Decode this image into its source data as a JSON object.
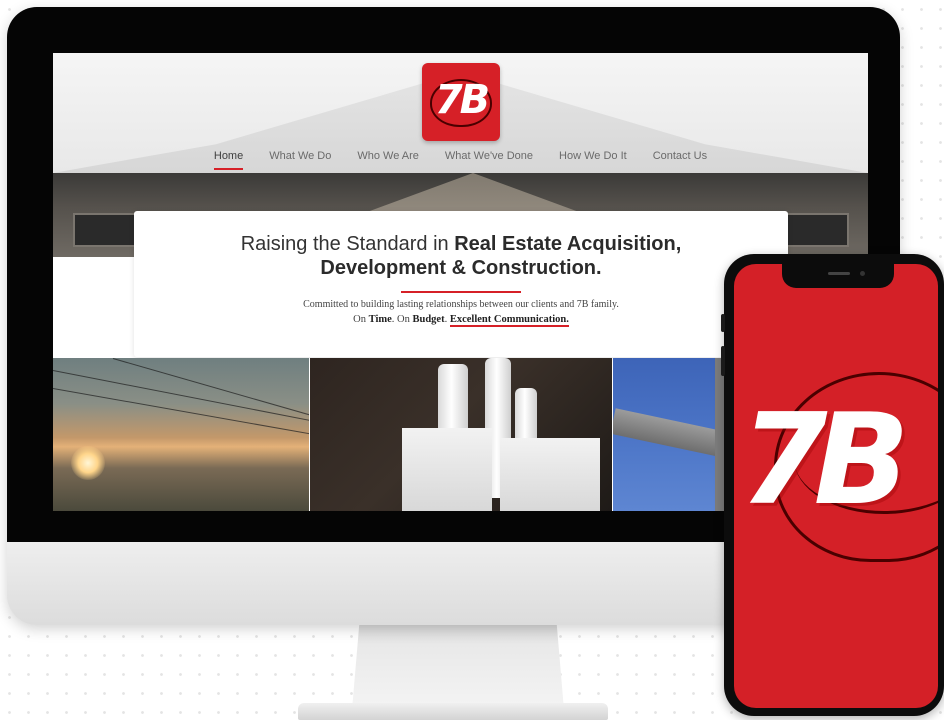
{
  "site": {
    "logo_text": "7B",
    "nav": [
      {
        "label": "Home",
        "active": true
      },
      {
        "label": "What We Do",
        "active": false
      },
      {
        "label": "Who We Are",
        "active": false
      },
      {
        "label": "What We've Done",
        "active": false
      },
      {
        "label": "How We Do It",
        "active": false
      },
      {
        "label": "Contact Us",
        "active": false
      }
    ],
    "hero": {
      "line1_prefix": "Raising the Standard in ",
      "line1_bold": "Real Estate Acquisition,",
      "line2": "Development & Construction.",
      "subtext": "Committed to building lasting relationships between our clients and 7B family.",
      "tag_on": "On ",
      "tag_time": "Time",
      "tag_mid": ". On ",
      "tag_budget": "Budget",
      "tag_sep": ". ",
      "tag_comm": "Excellent Communication."
    },
    "photos": [
      {
        "subject": "sunset-sky-with-power-lines"
      },
      {
        "subject": "rolled-blueprints"
      },
      {
        "subject": "steel-beam-against-blue-sky"
      }
    ]
  },
  "phone": {
    "logo_text": "7B"
  },
  "colors": {
    "brand_red": "#d62027",
    "bezel": "#050505",
    "nav_text": "#6a6a6a"
  }
}
